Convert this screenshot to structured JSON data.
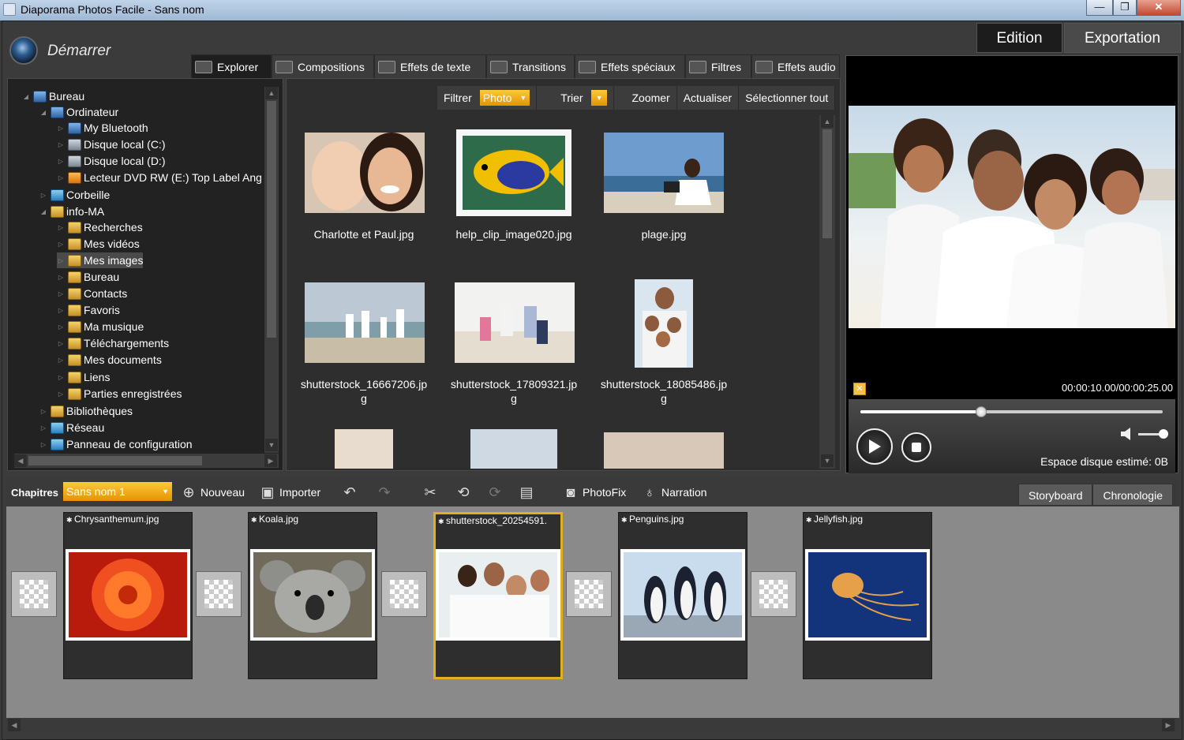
{
  "window": {
    "title": "Diaporama Photos Facile - Sans nom",
    "min": "—",
    "max": "❐",
    "close": "✕"
  },
  "header": {
    "start_label": "Démarrer"
  },
  "mode_tabs": {
    "edition": "Edition",
    "export": "Exportation",
    "active": "edition"
  },
  "category_tabs": [
    {
      "label": "Explorer",
      "icon": "folder-icon",
      "active": true
    },
    {
      "label": "Compositions",
      "icon": "image-icon"
    },
    {
      "label": "Effets de texte",
      "icon": "text-icon"
    },
    {
      "label": "Transitions",
      "icon": "transition-icon"
    },
    {
      "label": "Effets spéciaux",
      "icon": "clapper-icon"
    },
    {
      "label": "Filtres",
      "icon": "filter-icon"
    },
    {
      "label": "Effets audio",
      "icon": "headphones-icon"
    }
  ],
  "tree": [
    {
      "label": "Bureau",
      "indent": 0,
      "icon": "blue"
    },
    {
      "label": "Ordinateur",
      "indent": 1,
      "icon": "blue"
    },
    {
      "label": "My Bluetooth",
      "indent": 2,
      "icon": "blue"
    },
    {
      "label": "Disque local (C:)",
      "indent": 2,
      "icon": "grey"
    },
    {
      "label": "Disque local (D:)",
      "indent": 2,
      "icon": "grey"
    },
    {
      "label": "Lecteur DVD RW (E:) Top Label Ang",
      "indent": 2,
      "icon": "dvd"
    },
    {
      "label": "Corbeille",
      "indent": 1,
      "icon": "net"
    },
    {
      "label": "info-MA",
      "indent": 1,
      "icon": "folder"
    },
    {
      "label": "Recherches",
      "indent": 2,
      "icon": "folder"
    },
    {
      "label": "Mes vidéos",
      "indent": 2,
      "icon": "folder"
    },
    {
      "label": "Mes images",
      "indent": 2,
      "icon": "folder",
      "selected": true
    },
    {
      "label": "Bureau",
      "indent": 2,
      "icon": "folder"
    },
    {
      "label": "Contacts",
      "indent": 2,
      "icon": "folder"
    },
    {
      "label": "Favoris",
      "indent": 2,
      "icon": "folder"
    },
    {
      "label": "Ma musique",
      "indent": 2,
      "icon": "folder"
    },
    {
      "label": "Téléchargements",
      "indent": 2,
      "icon": "folder"
    },
    {
      "label": "Mes documents",
      "indent": 2,
      "icon": "folder"
    },
    {
      "label": "Liens",
      "indent": 2,
      "icon": "folder"
    },
    {
      "label": "Parties enregistrées",
      "indent": 2,
      "icon": "folder"
    },
    {
      "label": "Bibliothèques",
      "indent": 1,
      "icon": "folder"
    },
    {
      "label": "Réseau",
      "indent": 1,
      "icon": "net"
    },
    {
      "label": "Panneau de configuration",
      "indent": 1,
      "icon": "net"
    }
  ],
  "browser_toolbar": {
    "filter_label": "Filtrer",
    "filter_value": "Photo",
    "sort_label": "Trier",
    "zoom": "Zoomer",
    "refresh": "Actualiser",
    "select_all": "Sélectionner tout"
  },
  "files": [
    {
      "name": "Charlotte et Paul.jpg",
      "scene": "portrait"
    },
    {
      "name": "help_clip_image020.jpg",
      "scene": "fish"
    },
    {
      "name": "plage.jpg",
      "scene": "beach-laptop"
    },
    {
      "name": "shutterstock_16667206.jp\ng",
      "scene": "beach-family"
    },
    {
      "name": "shutterstock_17809321.jp\ng",
      "scene": "running"
    },
    {
      "name": "shutterstock_18085486.jp\ng",
      "scene": "family-tall"
    }
  ],
  "preview": {
    "timecode": "00:00:10.00/00:00:25.00",
    "progress": 0.4,
    "disk_space": "Espace disque estimé: 0B"
  },
  "bottom_toolbar": {
    "chapters_label": "Chapitres",
    "chapter_value": "Sans nom 1",
    "new": "Nouveau",
    "import": "Importer",
    "photofix": "PhotoFix",
    "narration": "Narration"
  },
  "view_tabs": {
    "storyboard": "Storyboard",
    "timeline": "Chronologie",
    "active": "storyboard"
  },
  "slides": [
    {
      "name": "Chrysanthemum.jpg",
      "scene": "flower"
    },
    {
      "name": "Koala.jpg",
      "scene": "koala"
    },
    {
      "name": "shutterstock_20254591.",
      "scene": "family-beach",
      "selected": true
    },
    {
      "name": "Penguins.jpg",
      "scene": "penguins"
    },
    {
      "name": "Jellyfish.jpg",
      "scene": "jellyfish"
    }
  ],
  "colors": {
    "accent": "#f0a000",
    "panel": "#222222",
    "storyboard_bg": "#8a8a8a",
    "selected_border": "#e0b020"
  }
}
